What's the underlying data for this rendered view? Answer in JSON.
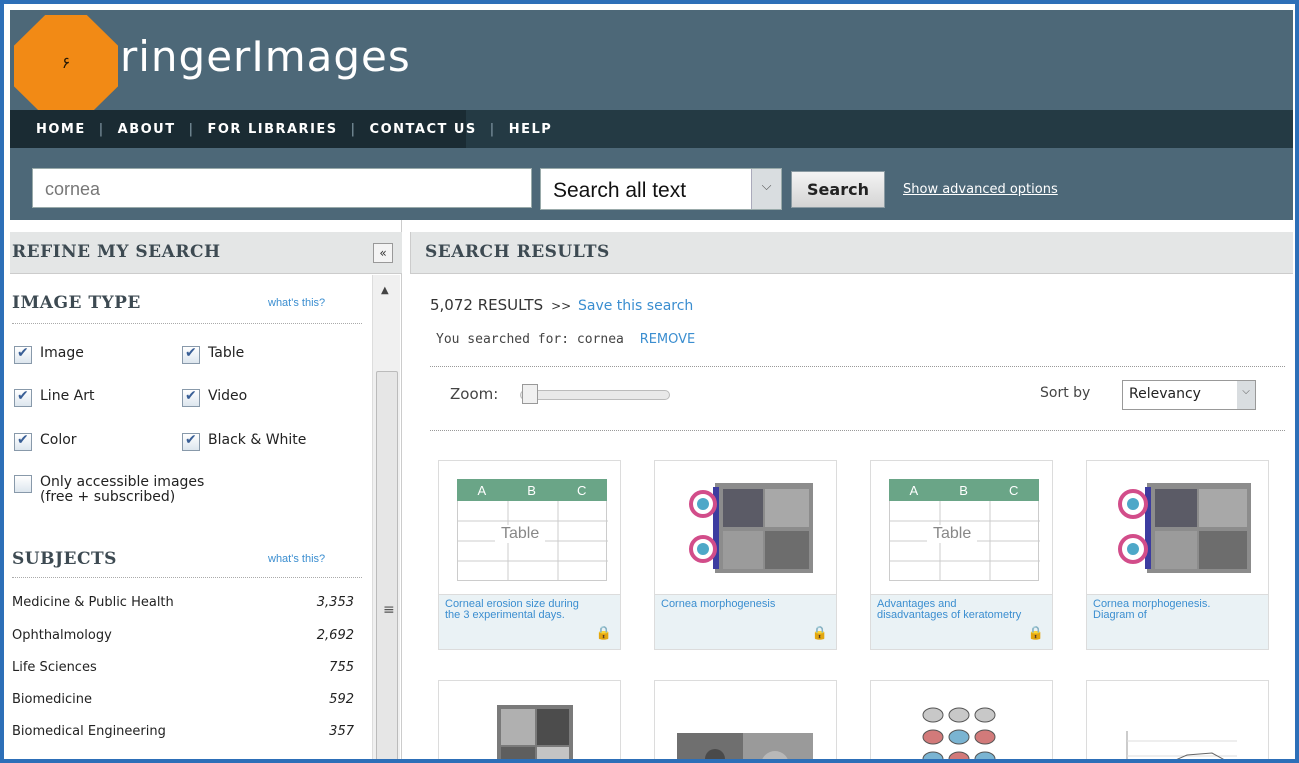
{
  "header": {
    "logo": "ringerImages",
    "badge": "۶"
  },
  "nav": {
    "items": [
      "HOME",
      "ABOUT",
      "FOR LIBRARIES",
      "CONTACT US",
      "HELP"
    ]
  },
  "search": {
    "query": "cornea",
    "scope": "Search all text",
    "button": "Search",
    "advanced": "Show advanced options"
  },
  "refine": {
    "title": "REFINE MY SEARCH",
    "collapse_icon": "double-chevron-left-icon",
    "image_type": {
      "title": "IMAGE TYPE",
      "whats_this": "what's this?",
      "options": [
        {
          "label": "Image",
          "checked": true
        },
        {
          "label": "Table",
          "checked": true
        },
        {
          "label": "Line Art",
          "checked": true
        },
        {
          "label": "Video",
          "checked": true
        },
        {
          "label": "Color",
          "checked": true
        },
        {
          "label": "Black & White",
          "checked": true
        }
      ],
      "accessible": {
        "line1": "Only accessible images",
        "line2": "(free + subscribed)",
        "checked": false
      }
    },
    "subjects": {
      "title": "SUBJECTS",
      "whats_this": "what's this?",
      "items": [
        {
          "name": "Medicine & Public Health",
          "count": "3,353"
        },
        {
          "name": "Ophthalmology",
          "count": "2,692"
        },
        {
          "name": "Life Sciences",
          "count": "755"
        },
        {
          "name": "Biomedicine",
          "count": "592"
        },
        {
          "name": "Biomedical Engineering",
          "count": "357"
        }
      ]
    }
  },
  "results": {
    "title": "SEARCH RESULTS",
    "count": "5,072 RESULTS",
    "arrows": ">>",
    "save": "Save this search",
    "searched_label": "You searched for:",
    "searched_term": "cornea",
    "remove": "REMOVE",
    "zoom_label": "Zoom:",
    "sort_label": "Sort by",
    "sort_value": "Relevancy",
    "table_cols": [
      "A",
      "B",
      "C"
    ],
    "table_word": "Table",
    "cards": [
      {
        "caption": "Corneal erosion size during the 3 experimental days.",
        "kind": "table"
      },
      {
        "caption": "Cornea morphogenesis",
        "kind": "micro"
      },
      {
        "caption": "Advantages and disadvantages of keratometry",
        "kind": "table"
      },
      {
        "caption": "Cornea morphogenesis. Diagram of",
        "kind": "micro"
      }
    ]
  },
  "colors": {
    "header": "#4d6878",
    "nav": "#243a44",
    "badge": "#f28a15",
    "link": "#3b8ed0",
    "table_header": "#6aa587"
  }
}
